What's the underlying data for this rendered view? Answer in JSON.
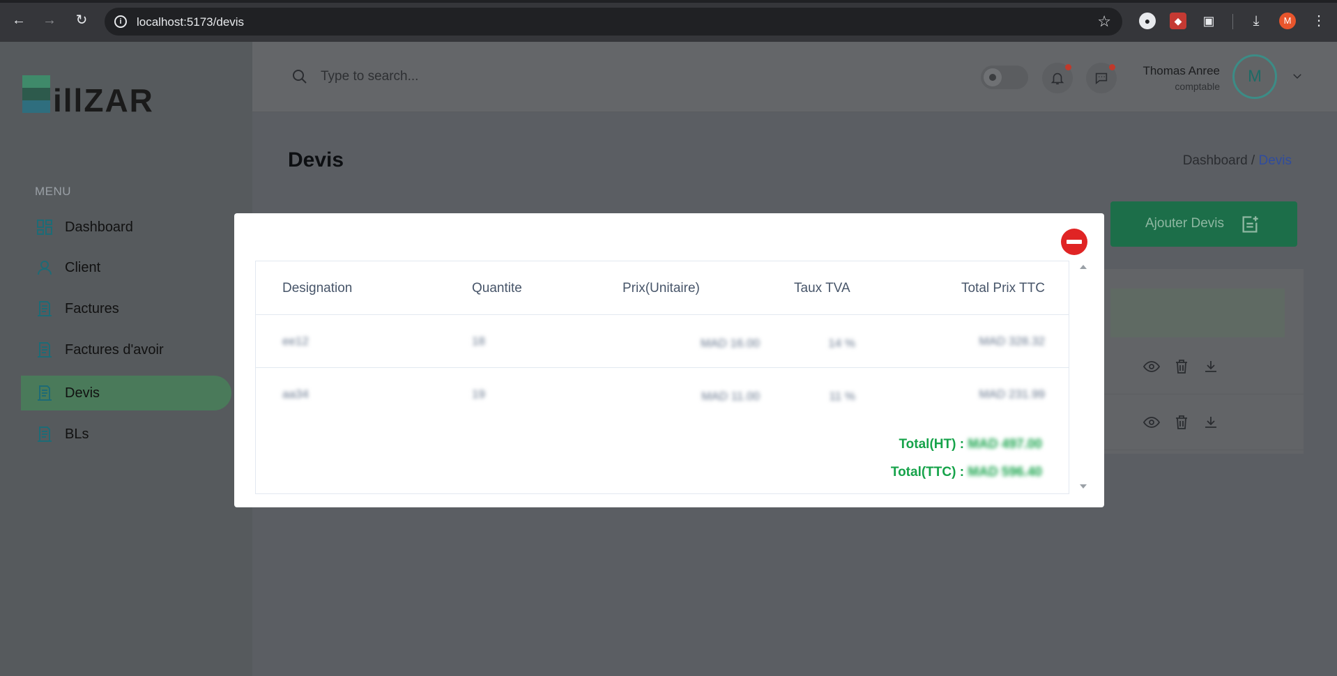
{
  "browser": {
    "url": "localhost:5173/devis",
    "profile_initial": "M"
  },
  "sidebar": {
    "logo_text": "Billzar",
    "menu_title": "MENU",
    "items": [
      {
        "label": "Dashboard",
        "icon": "dashboard-icon",
        "active": false
      },
      {
        "label": "Client",
        "icon": "user-icon",
        "active": false
      },
      {
        "label": "Factures",
        "icon": "receipt-icon",
        "active": false
      },
      {
        "label": "Factures d'avoir",
        "icon": "receipt-icon",
        "active": false
      },
      {
        "label": "Devis",
        "icon": "receipt-icon",
        "active": true
      },
      {
        "label": "BLs",
        "icon": "receipt-icon",
        "active": false
      }
    ]
  },
  "header": {
    "search_placeholder": "Type to search...",
    "user": {
      "name": "Thomas Anree",
      "role": "comptable",
      "avatar_initial": "M"
    }
  },
  "page": {
    "title": "Devis",
    "breadcrumb": {
      "parent": "Dashboard /",
      "current": "Devis"
    },
    "add_button_label": "Ajouter Devis"
  },
  "modal": {
    "columns": [
      "Designation",
      "Quantite",
      "Prix(Unitaire)",
      "Taux TVA",
      "Total Prix TTC"
    ],
    "rows": [
      {
        "designation": "ee12",
        "quantite": "18",
        "prix": "MAD 16.00",
        "tva": "14 %",
        "total": "MAD 328.32"
      },
      {
        "designation": "aa34",
        "quantite": "19",
        "prix": "MAD 11.00",
        "tva": "11 %",
        "total": "MAD 231.99"
      }
    ],
    "total_ht_label": "Total(HT) :",
    "total_ht_value": "MAD 497.00",
    "total_ttc_label": "Total(TTC) :",
    "total_ttc_value": "MAD 596.40"
  },
  "colors": {
    "accent": "#1c6e49",
    "success_text": "#16a34a",
    "danger": "#e02424"
  }
}
